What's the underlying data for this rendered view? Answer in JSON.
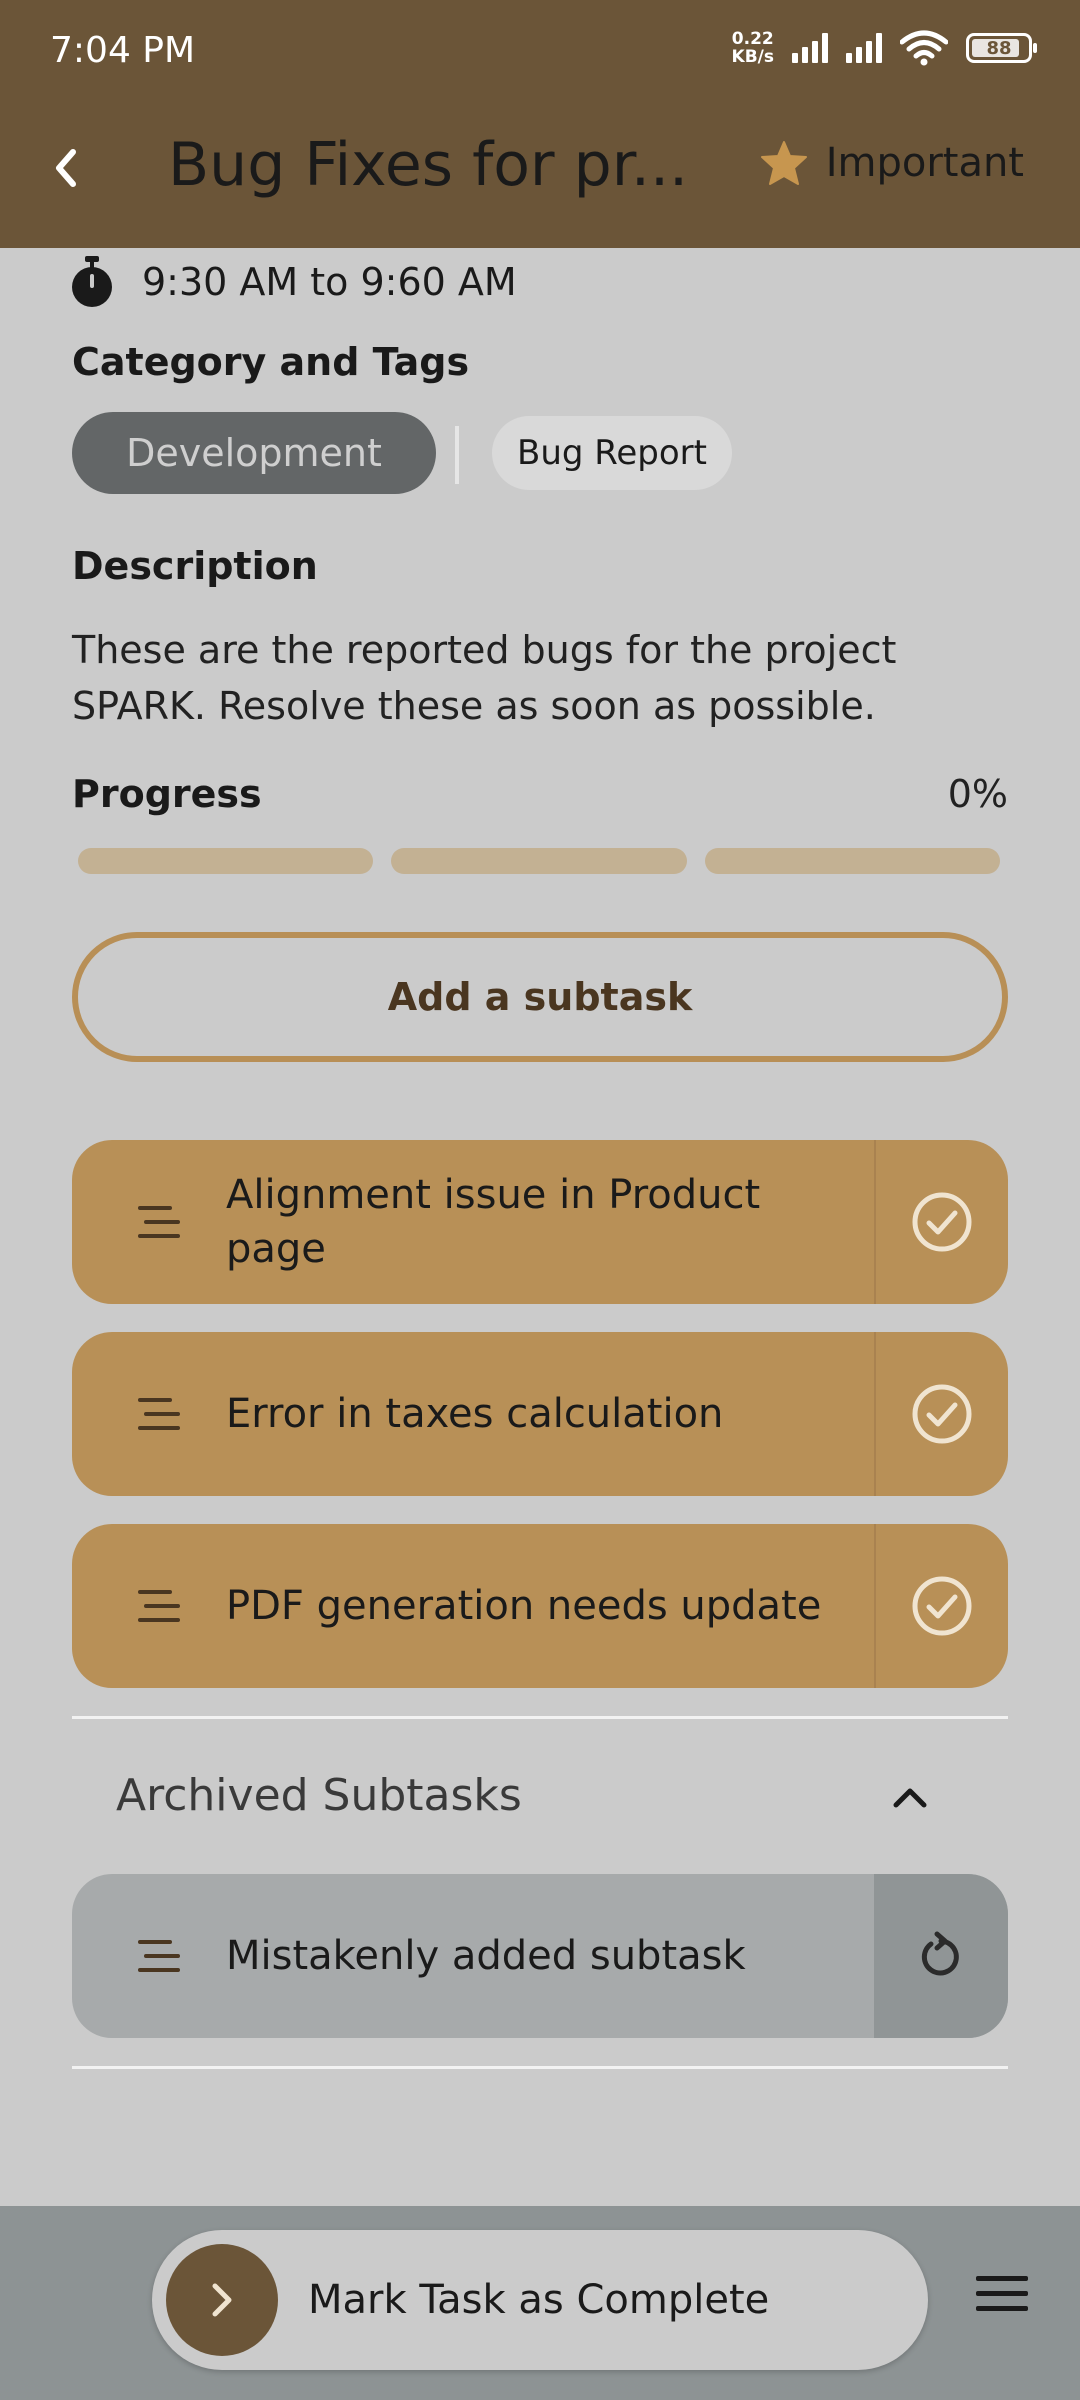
{
  "status_bar": {
    "time": "7:04 PM",
    "net_speed_value": "0.22",
    "net_speed_unit": "KB/s",
    "battery": "88"
  },
  "header": {
    "title": "Bug Fixes for pr...",
    "important_label": "Important",
    "accent_color": "#b88f56",
    "bar_color": "#6b5538"
  },
  "schedule": {
    "time_range": "9:30 AM to 9:60 AM"
  },
  "category": {
    "heading": "Category and Tags",
    "selected": "Development",
    "tags": [
      "Bug Report"
    ]
  },
  "description": {
    "heading": "Description",
    "text": "These are the reported bugs for the project SPARK. Resolve these as soon as possible."
  },
  "progress": {
    "heading": "Progress",
    "percent_label": "0%",
    "value": 0,
    "segments": 3
  },
  "add_subtask_label": "Add a subtask",
  "subtasks": [
    {
      "label": "Alignment issue in Product page",
      "icon": "check-circle-icon"
    },
    {
      "label": "Error in taxes calculation",
      "icon": "check-circle-icon"
    },
    {
      "label": "PDF generation needs update",
      "icon": "check-circle-icon"
    }
  ],
  "archived": {
    "heading": "Archived Subtasks",
    "expanded": true,
    "items": [
      {
        "label": "Mistakenly added subtask",
        "icon": "restore-icon"
      }
    ]
  },
  "footer": {
    "complete_label": "Mark Task as Complete"
  }
}
